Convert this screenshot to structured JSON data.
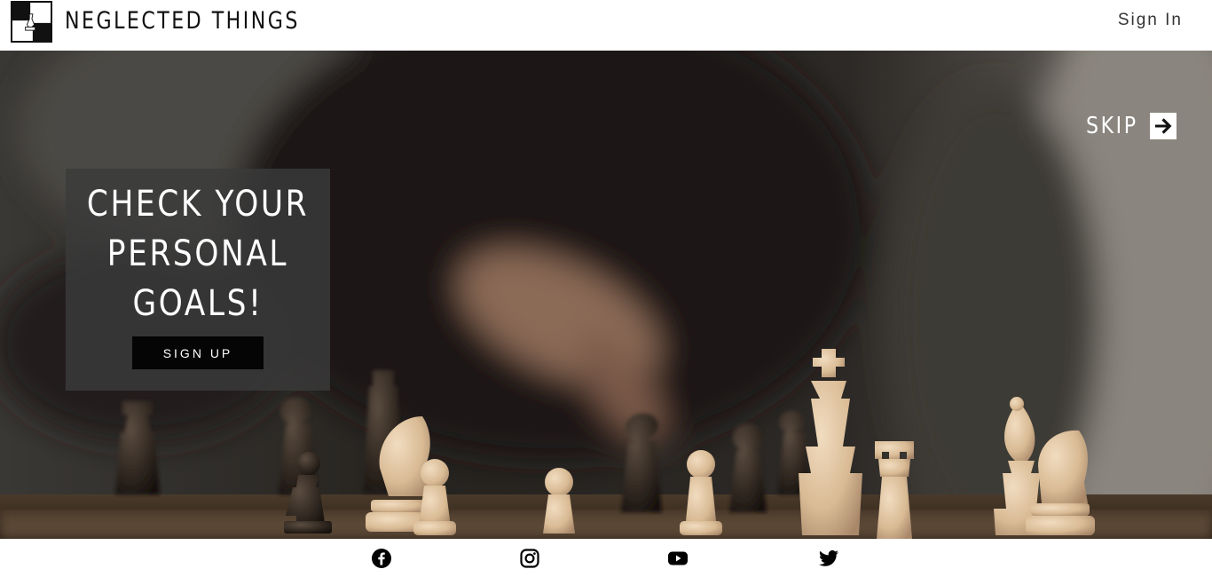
{
  "header": {
    "brand_title": "NEGLECTED THINGS",
    "sign_in_label": "Sign In",
    "logo_icon": "chess-board-logo-icon"
  },
  "hero": {
    "skip_label": "SKIP",
    "skip_icon": "arrow-right-icon",
    "cta_heading_lines": [
      "CHECK YOUR",
      "PERSONAL",
      "GOALS!"
    ],
    "signup_label": "SIGN UP"
  },
  "social": {
    "icons": [
      "facebook-icon",
      "instagram-icon",
      "youtube-icon",
      "twitter-icon"
    ]
  },
  "colors": {
    "header_bg": "#ffffff",
    "cta_card_bg": "#3a3a3a",
    "signup_button_bg": "#050505",
    "text_light": "#ffffff",
    "text_dark": "#111111"
  }
}
